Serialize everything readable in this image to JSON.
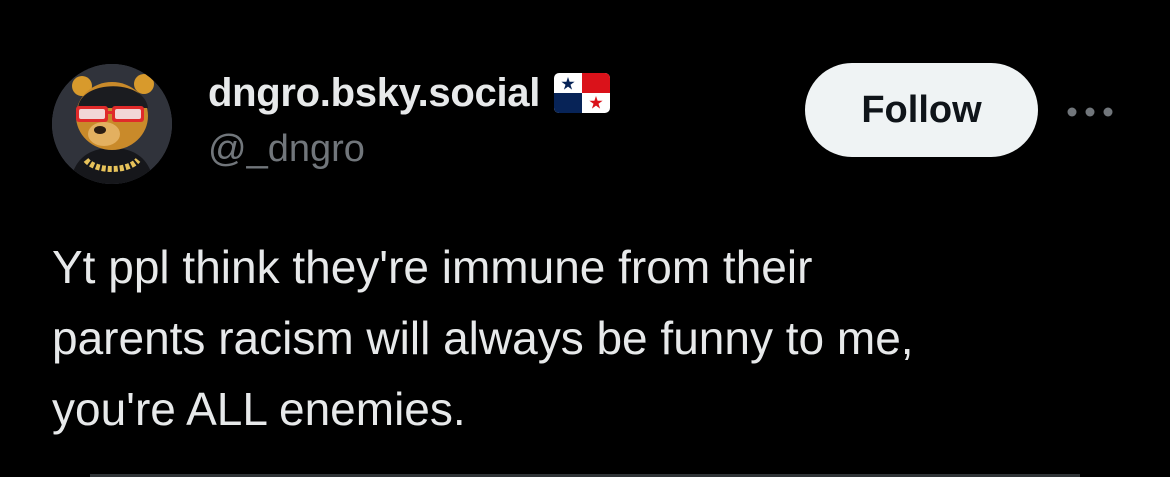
{
  "author": {
    "display_name": "dngro.bsky.social",
    "handle": "@_dngro",
    "avatar_icon": "bear-avatar-with-sunglasses-and-chain",
    "flag_icon": "panama-flag-icon"
  },
  "actions": {
    "follow_label": "Follow",
    "more_icon": "more-horizontal-icon"
  },
  "tweet": {
    "text": "Yt ppl think they're immune from their\nparents racism will always be funny to me,\nyou're ALL enemies."
  },
  "colors": {
    "background": "#000000",
    "primary_text": "#e7e9ea",
    "secondary_text": "#71767b",
    "follow_bg": "#eff3f4",
    "follow_text": "#0f1419",
    "flag_red": "#da121a",
    "flag_blue": "#072357"
  }
}
